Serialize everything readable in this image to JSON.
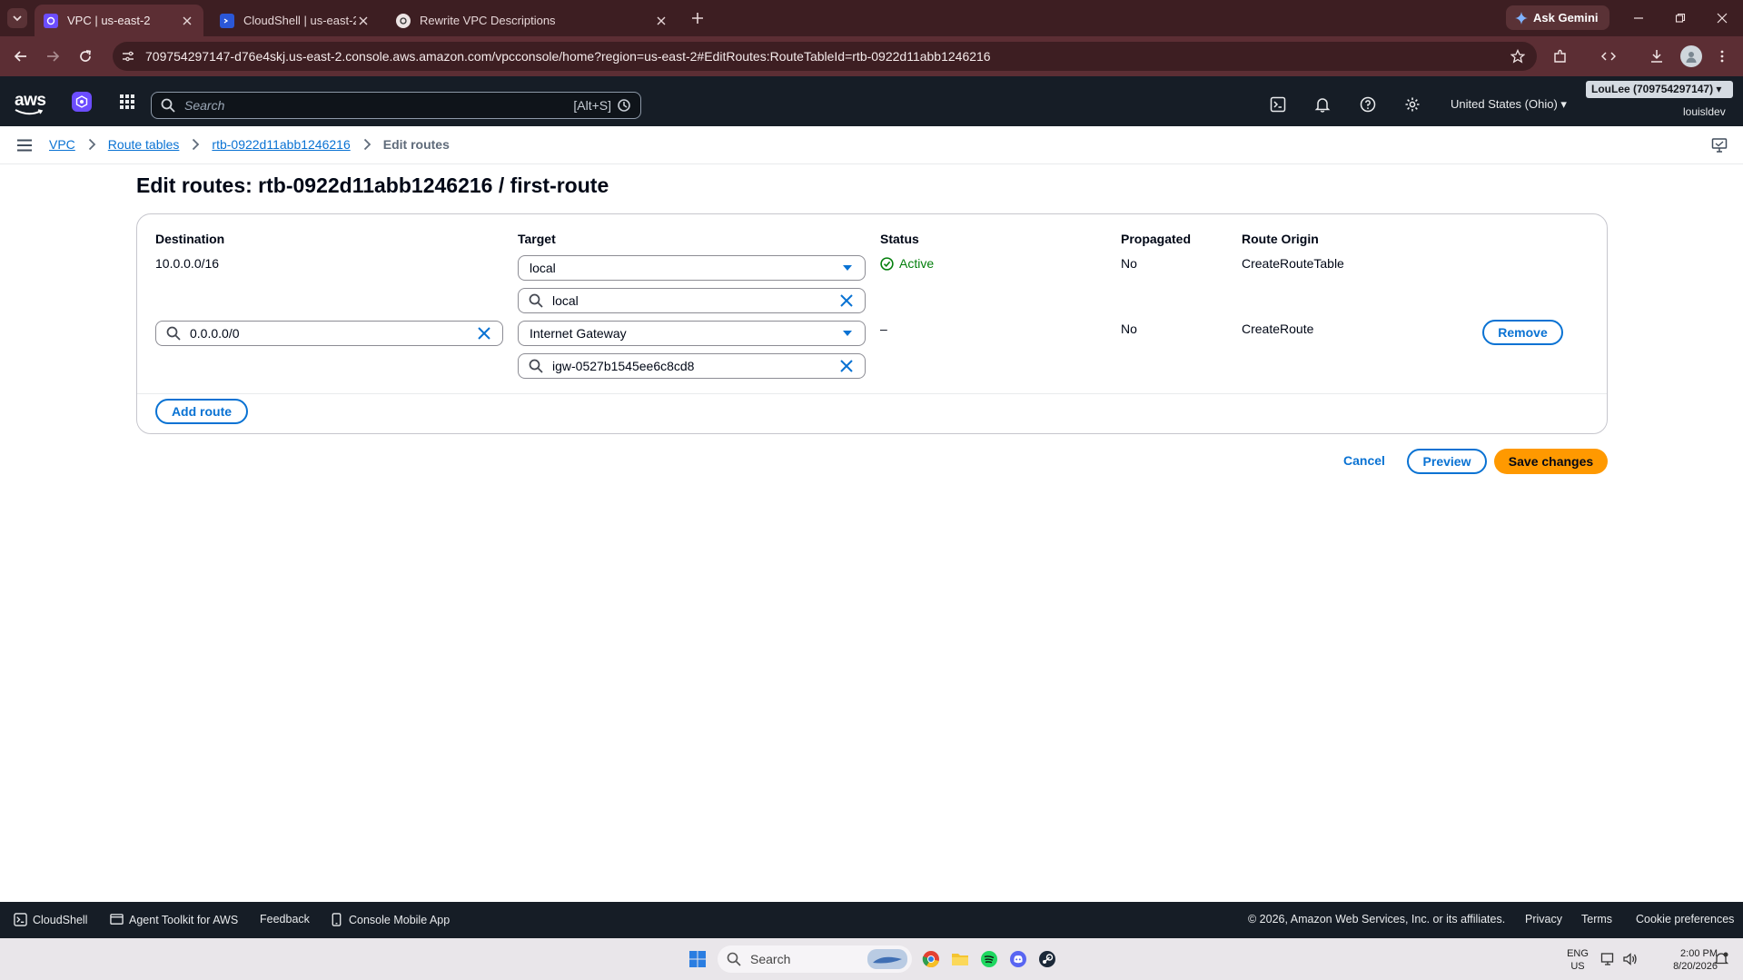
{
  "browser": {
    "tabs": [
      {
        "title": "VPC | us-east-2",
        "active": true
      },
      {
        "title": "CloudShell | us-east-2",
        "active": false
      },
      {
        "title": "Rewrite VPC Descriptions",
        "active": false
      }
    ],
    "ask_gemini": "Ask Gemini",
    "url": "709754297147-d76e4skj.us-east-2.console.aws.amazon.com/vpcconsole/home?region=us-east-2#EditRoutes:RouteTableId=rtb-0922d11abb1246216"
  },
  "console": {
    "logo": "aws",
    "search": {
      "placeholder": "Search",
      "shortcut": "[Alt+S]"
    },
    "region": "United States (Ohio) ▾",
    "account": "LouLee (709754297147) ▾",
    "user": "louisldev"
  },
  "breadcrumb": {
    "items": [
      "VPC",
      "Route tables",
      "rtb-0922d11abb1246216"
    ],
    "current": "Edit routes"
  },
  "page": {
    "title": "Edit routes: rtb-0922d11abb1246216 / first-route",
    "columns": {
      "destination": "Destination",
      "target": "Target",
      "status": "Status",
      "propagated": "Propagated",
      "origin": "Route Origin"
    },
    "routes": [
      {
        "destination": "10.0.0.0/16",
        "target_type": "local",
        "target_search": "local",
        "status": "Active",
        "propagated": "No",
        "origin": "CreateRouteTable"
      },
      {
        "destination": "0.0.0.0/0",
        "target_type": "Internet Gateway",
        "target_search": "igw-0527b1545ee6c8cd8",
        "status": "–",
        "propagated": "No",
        "origin": "CreateRoute",
        "remove_label": "Remove"
      }
    ],
    "add_route": "Add route",
    "actions": {
      "cancel": "Cancel",
      "preview": "Preview",
      "save": "Save changes"
    }
  },
  "footer": {
    "cloudshell": "CloudShell",
    "agent_toolkit": "Agent Toolkit for AWS",
    "feedback": "Feedback",
    "mobile_app": "Console Mobile App",
    "copyright": "© 2026, Amazon Web Services, Inc. or its affiliates.",
    "privacy": "Privacy",
    "terms": "Terms",
    "cookies": "Cookie preferences"
  },
  "taskbar": {
    "search": "Search",
    "lang_top": "ENG",
    "lang_bottom": "US",
    "time": "2:00 PM",
    "date": "8/20/2026"
  },
  "colors": {
    "browser_frame": "#3d1e22",
    "browser_toolbar": "#5c2e34",
    "console_nav": "#161d26",
    "link": "#0972d3",
    "primary_button": "#ff9900",
    "success": "#037f0c"
  }
}
